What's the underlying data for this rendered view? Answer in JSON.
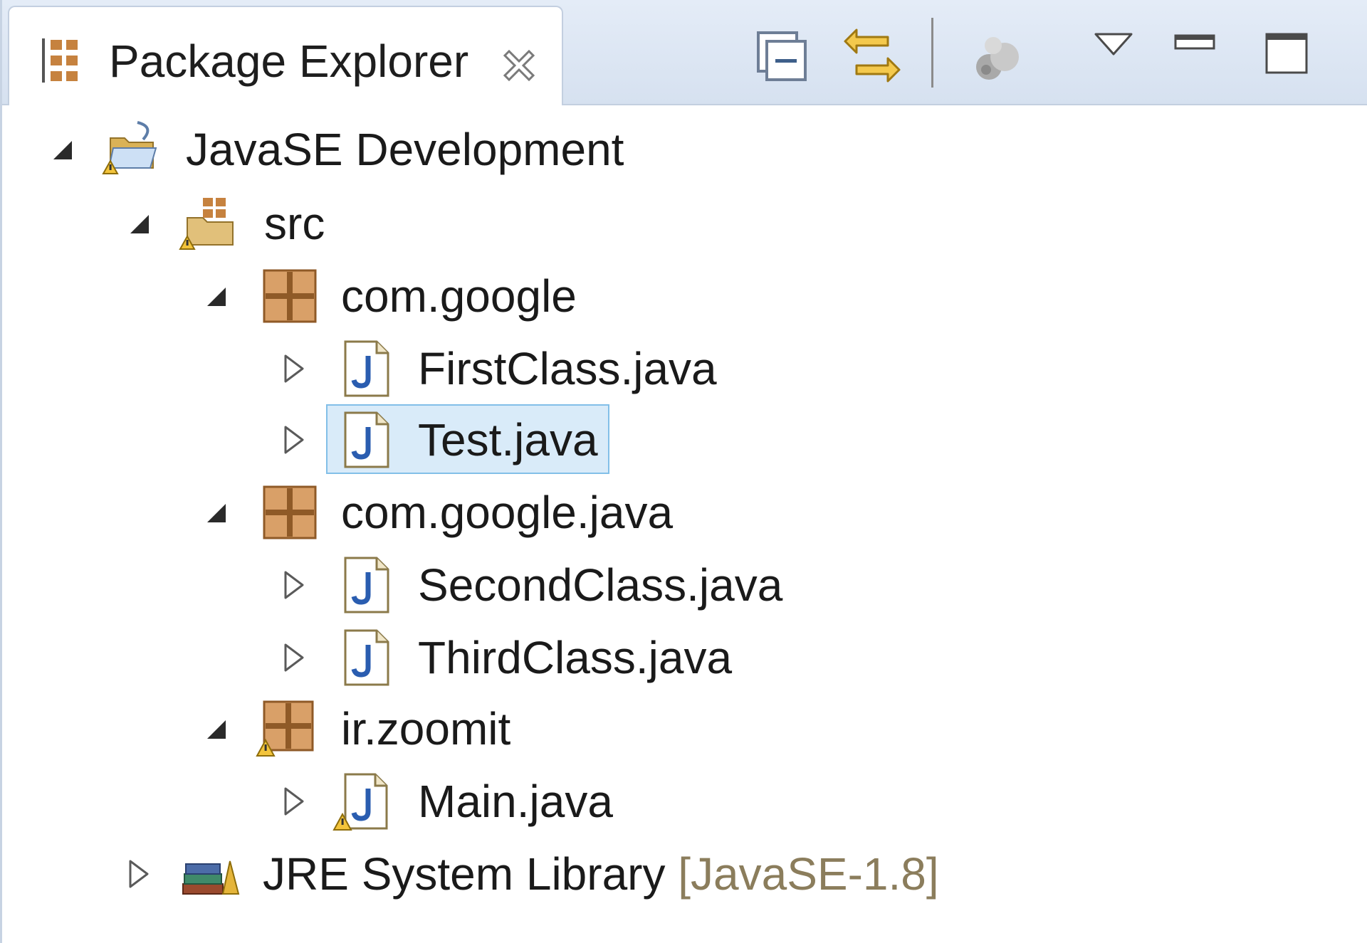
{
  "view": {
    "tab_title": "Package Explorer"
  },
  "toolbar": {
    "buttons": [
      "collapse-all-icon",
      "link-with-editor-icon",
      "focus-on-active-task-icon",
      "view-menu-icon",
      "minimize-icon",
      "maximize-icon"
    ]
  },
  "tree": {
    "project": {
      "label": "JavaSE Development",
      "expanded": true
    },
    "src": {
      "label": "src",
      "expanded": true
    },
    "packages": [
      {
        "label": "com.google",
        "expanded": true,
        "files": [
          "FirstClass.java",
          "Test.java"
        ]
      },
      {
        "label": "com.google.java",
        "expanded": true,
        "files": [
          "SecondClass.java",
          "ThirdClass.java"
        ]
      },
      {
        "label": "ir.zoomit",
        "expanded": true,
        "warning": true,
        "files": [
          "Main.java"
        ]
      }
    ],
    "library": {
      "label": "JRE System Library",
      "decoration": "[JavaSE-1.8]",
      "expanded": false
    },
    "selected": "Test.java"
  },
  "colors": {
    "selection_fill": "#d9ebf9",
    "selection_border": "#82bfe8",
    "package_brown": "#b5733d",
    "java_blue": "#2a5db0",
    "warning_yellow": "#f3c43b",
    "titlebar": "#dfe8f5"
  }
}
